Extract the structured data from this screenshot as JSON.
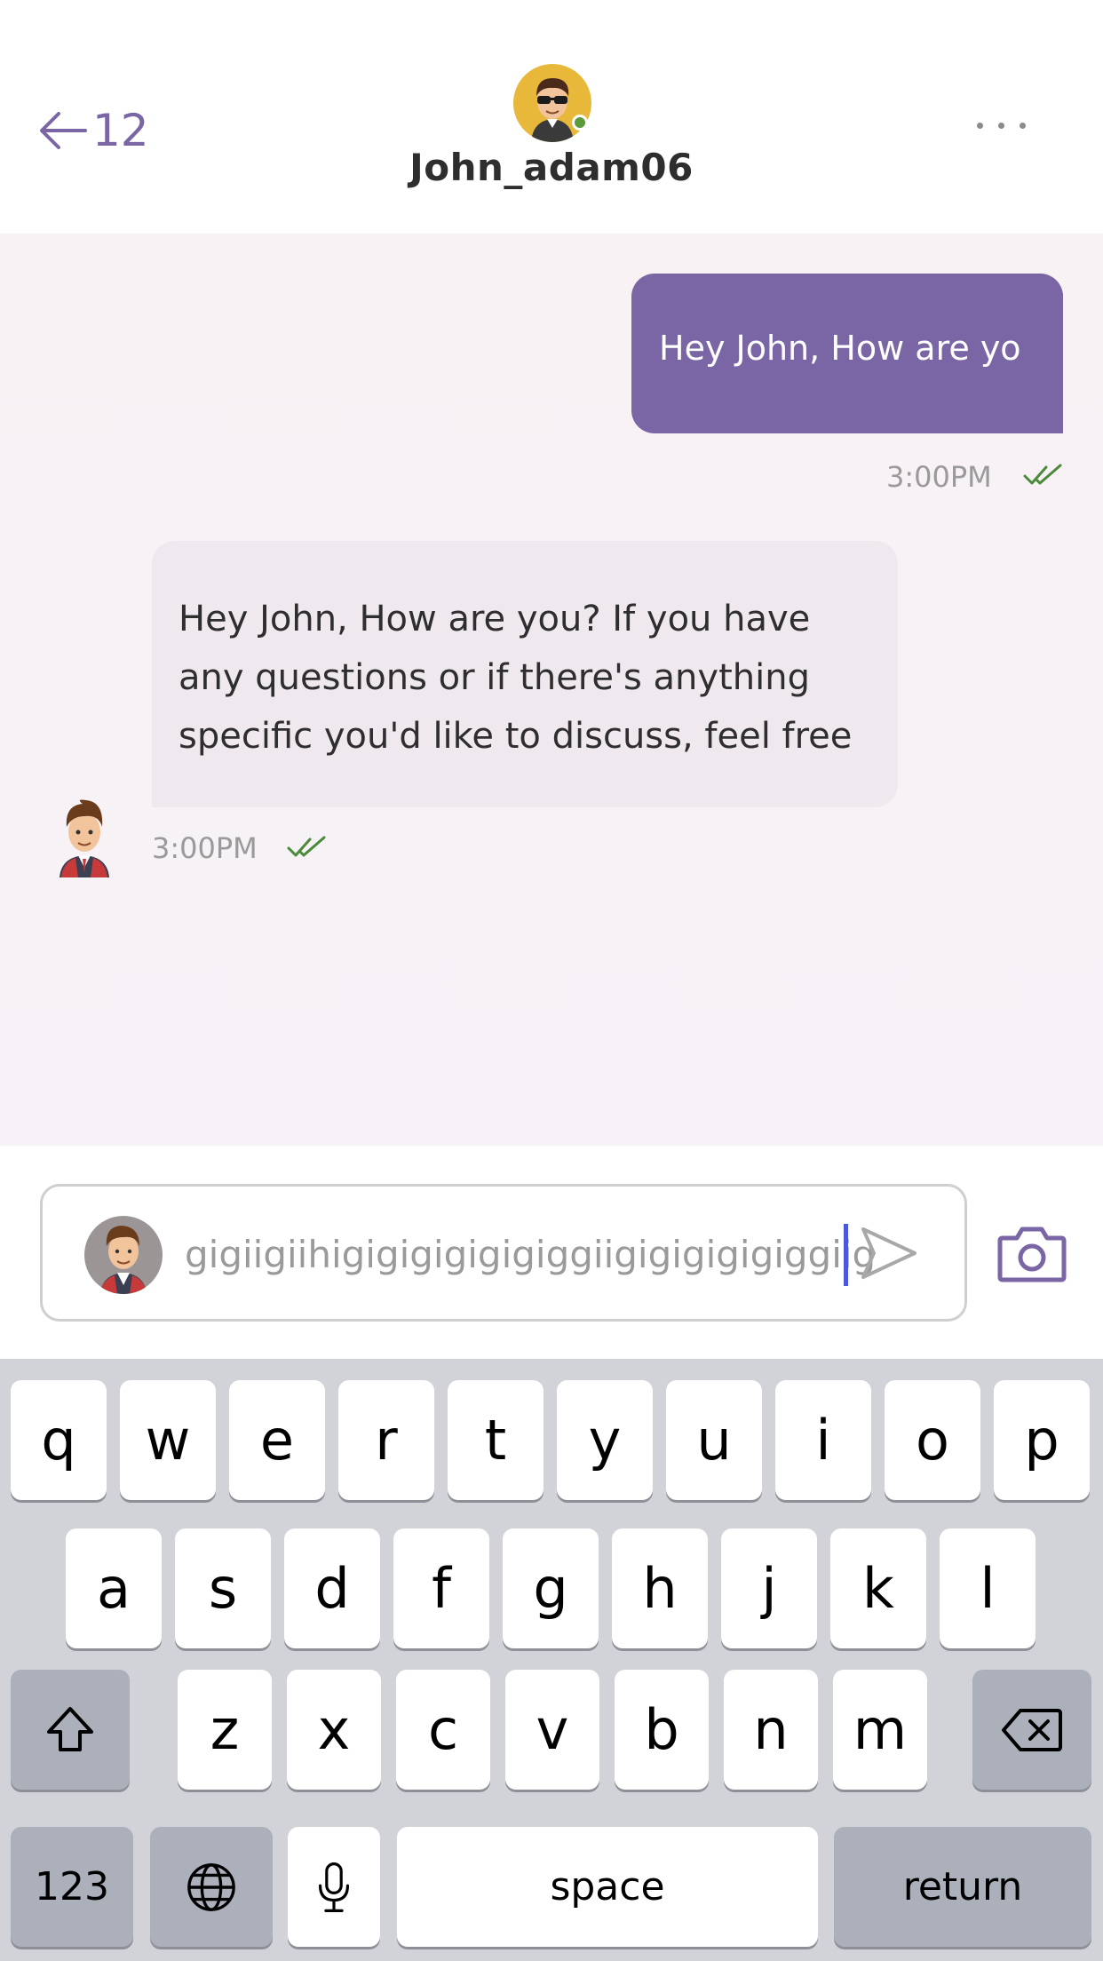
{
  "header": {
    "back_count": "12",
    "username": "John_adam06",
    "online": true
  },
  "messages": [
    {
      "direction": "outgoing",
      "text": "Hey John, How are yo",
      "time": "3:00PM",
      "status": "read"
    },
    {
      "direction": "incoming",
      "text": "Hey John,   How are you? If you have any questions or if there's anything specific you'd like to discuss, feel free",
      "time": "3:00PM",
      "status": "read"
    }
  ],
  "composer": {
    "value": "gigiigiihigigigigigigiggiigigigigigiggiig"
  },
  "keyboard": {
    "row1": [
      "q",
      "w",
      "e",
      "r",
      "t",
      "y",
      "u",
      "i",
      "o",
      "p"
    ],
    "row2": [
      "a",
      "s",
      "d",
      "f",
      "g",
      "h",
      "j",
      "k",
      "l"
    ],
    "row3": [
      "z",
      "x",
      "c",
      "v",
      "b",
      "n",
      "m"
    ],
    "numbers_label": "123",
    "space_label": "space",
    "return_label": "return"
  },
  "colors": {
    "accent": "#7a66a5",
    "online": "#5a9a3c",
    "read_check": "#4a8a3a",
    "caret": "#4a58d9"
  }
}
